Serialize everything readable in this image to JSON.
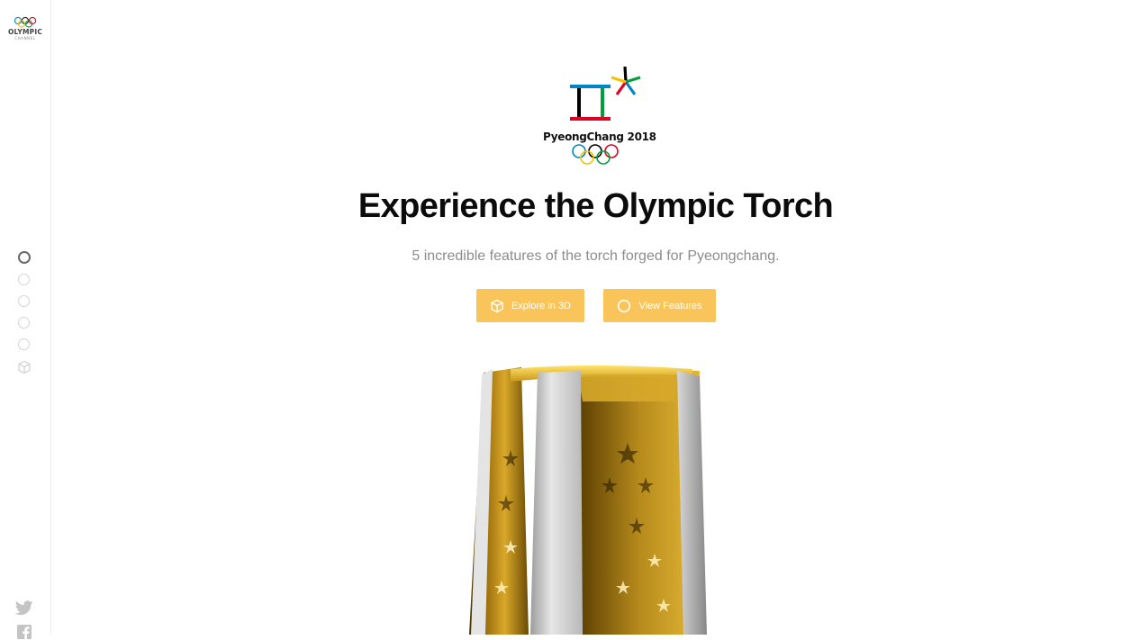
{
  "sidebar": {
    "logo_text": "OLYMPIC",
    "logo_subtext": "CHANNEL",
    "nav_dots": [
      {
        "name": "section-1",
        "active": true
      },
      {
        "name": "section-2",
        "active": false
      },
      {
        "name": "section-3",
        "active": false
      },
      {
        "name": "section-4",
        "active": false
      },
      {
        "name": "section-5",
        "active": false
      }
    ],
    "nav_cube_icon": "cube-icon",
    "social_icons": [
      "twitter-icon",
      "facebook-icon"
    ]
  },
  "hero": {
    "emblem_text": "PyeongChang 2018",
    "title": "Experience the Olympic Torch",
    "subtitle": "5 incredible features of the torch forged for Pyeongchang.",
    "buttons": {
      "explore_label": "Explore in 3D",
      "explore_icon": "cube-icon",
      "features_label": "View Features",
      "features_icon": "circle-icon"
    }
  },
  "colors": {
    "accent": "#f9c55a",
    "title": "#0b0b0b",
    "subtitle": "#8c8c8c",
    "ring_blue": "#0085c7",
    "ring_yellow": "#f4c300",
    "ring_black": "#000000",
    "ring_green": "#009f3d",
    "ring_red": "#df0024"
  }
}
